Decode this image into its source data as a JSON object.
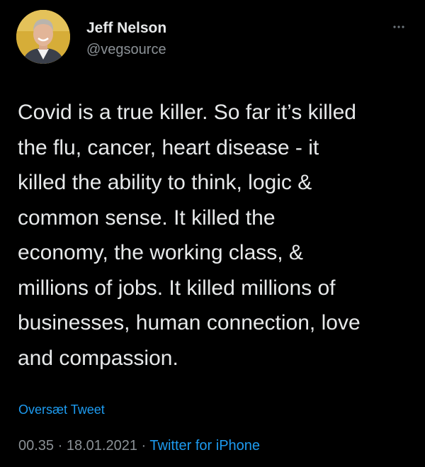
{
  "author": {
    "display_name": "Jeff Nelson",
    "handle": "@vegsource",
    "avatar_icon": "user-avatar-photo"
  },
  "menu": {
    "icon": "more-options-icon"
  },
  "tweet": {
    "text": "Covid is a true killer. So far it’s killed\nthe flu, cancer, heart disease - it\nkilled the ability to think, logic &\ncommon sense. It killed the\neconomy, the working class, &\nmillions of jobs. It killed millions of\nbusinesses, human connection, love\nand compassion.",
    "translate_label": "Oversæt Tweet"
  },
  "meta": {
    "time": "00.35",
    "separator": "·",
    "date": "18.01.2021",
    "source": "Twitter for iPhone"
  },
  "colors": {
    "background": "#000000",
    "text": "#e7e9ea",
    "muted": "#8b9196",
    "link": "#1d9bf0"
  }
}
